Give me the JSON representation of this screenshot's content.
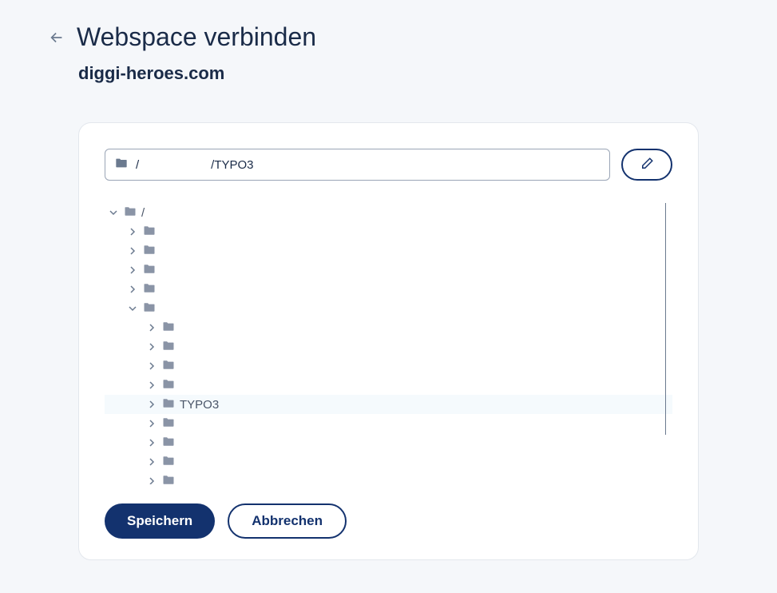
{
  "header": {
    "title": "Webspace verbinden",
    "subtitle": "diggi-heroes.com"
  },
  "path": {
    "prefix": "/",
    "segment": "/TYPO3"
  },
  "tree": {
    "items": [
      {
        "level": 0,
        "expanded": true,
        "label": "/",
        "selected": false
      },
      {
        "level": 1,
        "expanded": false,
        "label": "",
        "selected": false
      },
      {
        "level": 1,
        "expanded": false,
        "label": "",
        "selected": false
      },
      {
        "level": 1,
        "expanded": false,
        "label": "",
        "selected": false
      },
      {
        "level": 1,
        "expanded": false,
        "label": "",
        "selected": false
      },
      {
        "level": 1,
        "expanded": true,
        "label": "",
        "selected": false
      },
      {
        "level": 2,
        "expanded": false,
        "label": "",
        "selected": false
      },
      {
        "level": 2,
        "expanded": false,
        "label": "",
        "selected": false
      },
      {
        "level": 2,
        "expanded": false,
        "label": "",
        "selected": false
      },
      {
        "level": 2,
        "expanded": false,
        "label": "",
        "selected": false
      },
      {
        "level": 2,
        "expanded": false,
        "label": "TYPO3",
        "selected": true
      },
      {
        "level": 2,
        "expanded": false,
        "label": "",
        "selected": false
      },
      {
        "level": 2,
        "expanded": false,
        "label": "",
        "selected": false
      },
      {
        "level": 2,
        "expanded": false,
        "label": "",
        "selected": false
      },
      {
        "level": 2,
        "expanded": false,
        "label": "",
        "selected": false
      }
    ]
  },
  "buttons": {
    "save": "Speichern",
    "cancel": "Abbrechen"
  }
}
